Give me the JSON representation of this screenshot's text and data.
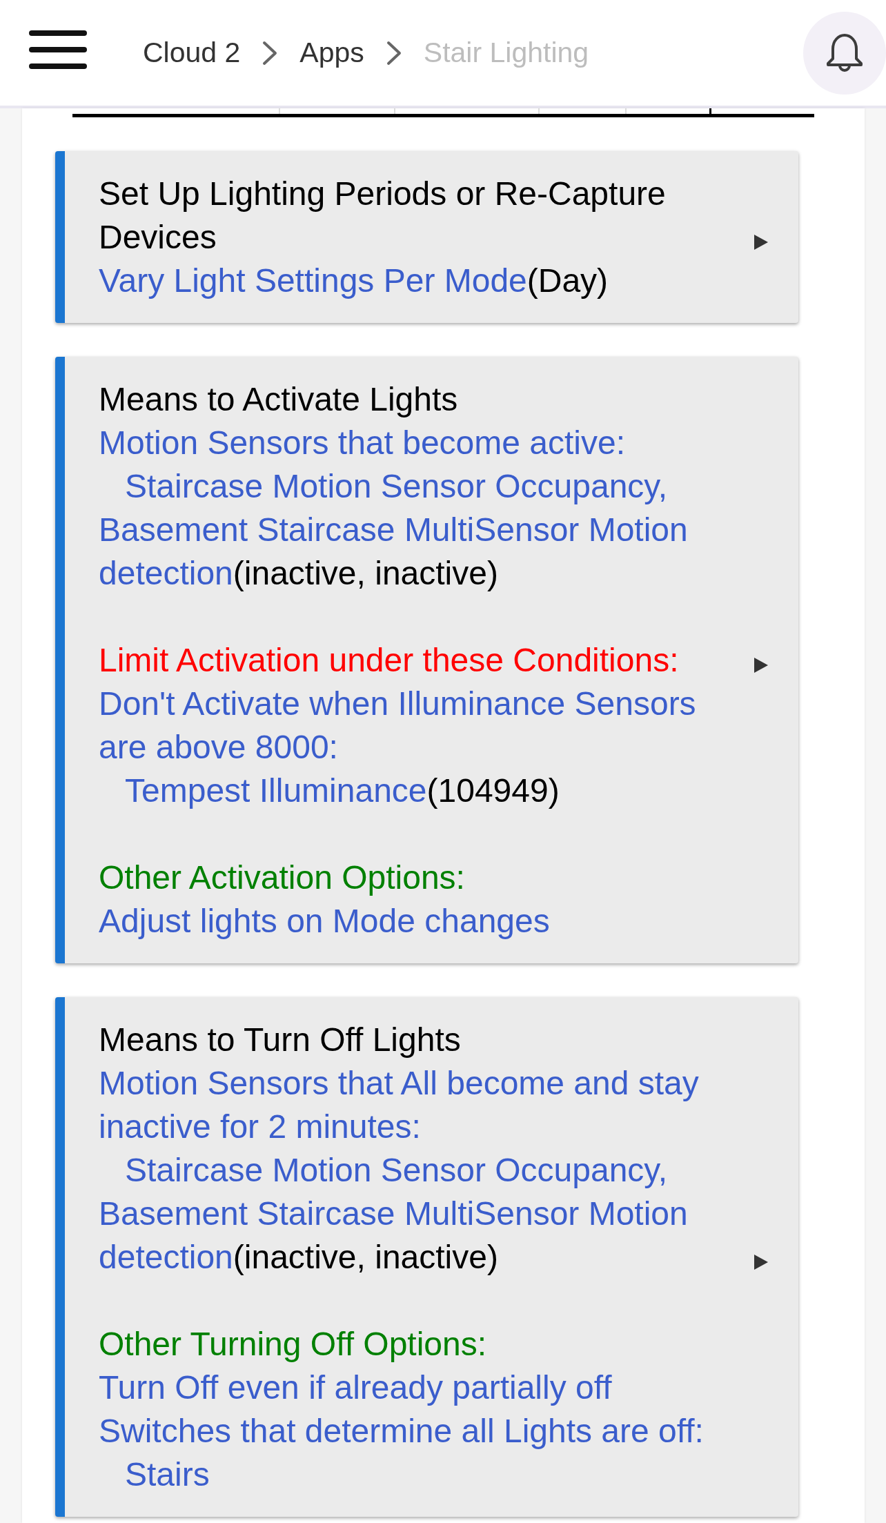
{
  "header": {
    "breadcrumbs": [
      {
        "label": "Cloud 2",
        "current": false
      },
      {
        "label": "Apps",
        "current": false
      },
      {
        "label": "Stair Lighting",
        "current": true
      }
    ]
  },
  "cards": [
    {
      "title": "Set Up Lighting Periods or Re-Capture Devices",
      "groups": [
        [
          {
            "kind": "link",
            "text": "Vary Light Settings Per Mode",
            "value": "(Day)"
          }
        ]
      ]
    },
    {
      "title": "Means to Activate Lights",
      "groups": [
        [
          {
            "kind": "link",
            "text": "Motion Sensors that become active:"
          },
          {
            "kind": "device",
            "text": "Staircase Motion Sensor Occupancy, Basement Staircase MultiSensor Motion detection",
            "value": "(inactive, inactive)"
          }
        ],
        [
          {
            "kind": "condition",
            "text": "Limit Activation under these Conditions:"
          },
          {
            "kind": "link",
            "text": "Don't Activate when Illuminance Sensors are above 8000:"
          },
          {
            "kind": "device",
            "text": "Tempest Illuminance",
            "value": "(104949)"
          }
        ],
        [
          {
            "kind": "option",
            "text": "Other Activation Options:"
          },
          {
            "kind": "link",
            "text": "Adjust lights on Mode changes"
          }
        ]
      ]
    },
    {
      "title": "Means to Turn Off Lights",
      "groups": [
        [
          {
            "kind": "link",
            "text": "Motion Sensors that All become and stay inactive for 2 minutes:"
          },
          {
            "kind": "device",
            "text": "Staircase Motion Sensor Occupancy, Basement Staircase MultiSensor Motion detection",
            "value": "(inactive, inactive)"
          }
        ],
        [
          {
            "kind": "option",
            "text": "Other Turning Off Options:"
          },
          {
            "kind": "link",
            "text": "Turn Off even if already partially off"
          },
          {
            "kind": "link",
            "text": "Switches that determine all Lights are off:"
          },
          {
            "kind": "device",
            "text": "Stairs"
          }
        ]
      ]
    }
  ]
}
